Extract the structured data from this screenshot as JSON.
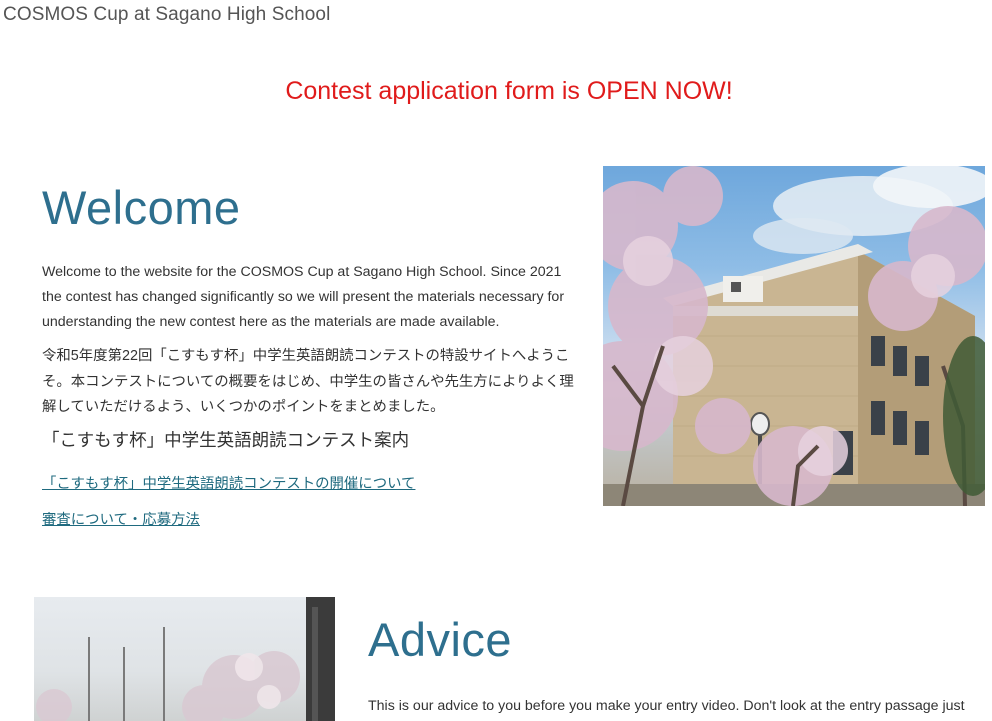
{
  "header": {
    "site_title": "COSMOS Cup at Sagano High School"
  },
  "announcement": {
    "text": "Contest application form is OPEN NOW!",
    "color": "#e01b1b"
  },
  "welcome": {
    "heading": "Welcome",
    "intro_en": "Welcome to the website for the COSMOS Cup at Sagano High School. Since 2021 the contest has changed significantly so we will present the materials necessary for understanding the new contest here as the materials are made available.",
    "intro_jp": "令和5年度第22回「こすもす杯」中学生英語朗読コンテストの特設サイトへようこそ。本コンテストについての概要をはじめ、中学生の皆さんや先生方によりよく理解していただけるよう、いくつかのポイントをまとめました。",
    "subheading": "「こすもす杯」中学生英語朗読コンテスト案内",
    "links": [
      "「こすもす杯」中学生英語朗読コンテストの開催について",
      "審査について・応募方法"
    ]
  },
  "advice": {
    "heading": "Advice",
    "intro": "This is our advice to you before you make your entry video.  Don't look at the entry passage just"
  },
  "theme": {
    "heading_color": "#2e6f8e",
    "link_color": "#1f6a7f"
  }
}
